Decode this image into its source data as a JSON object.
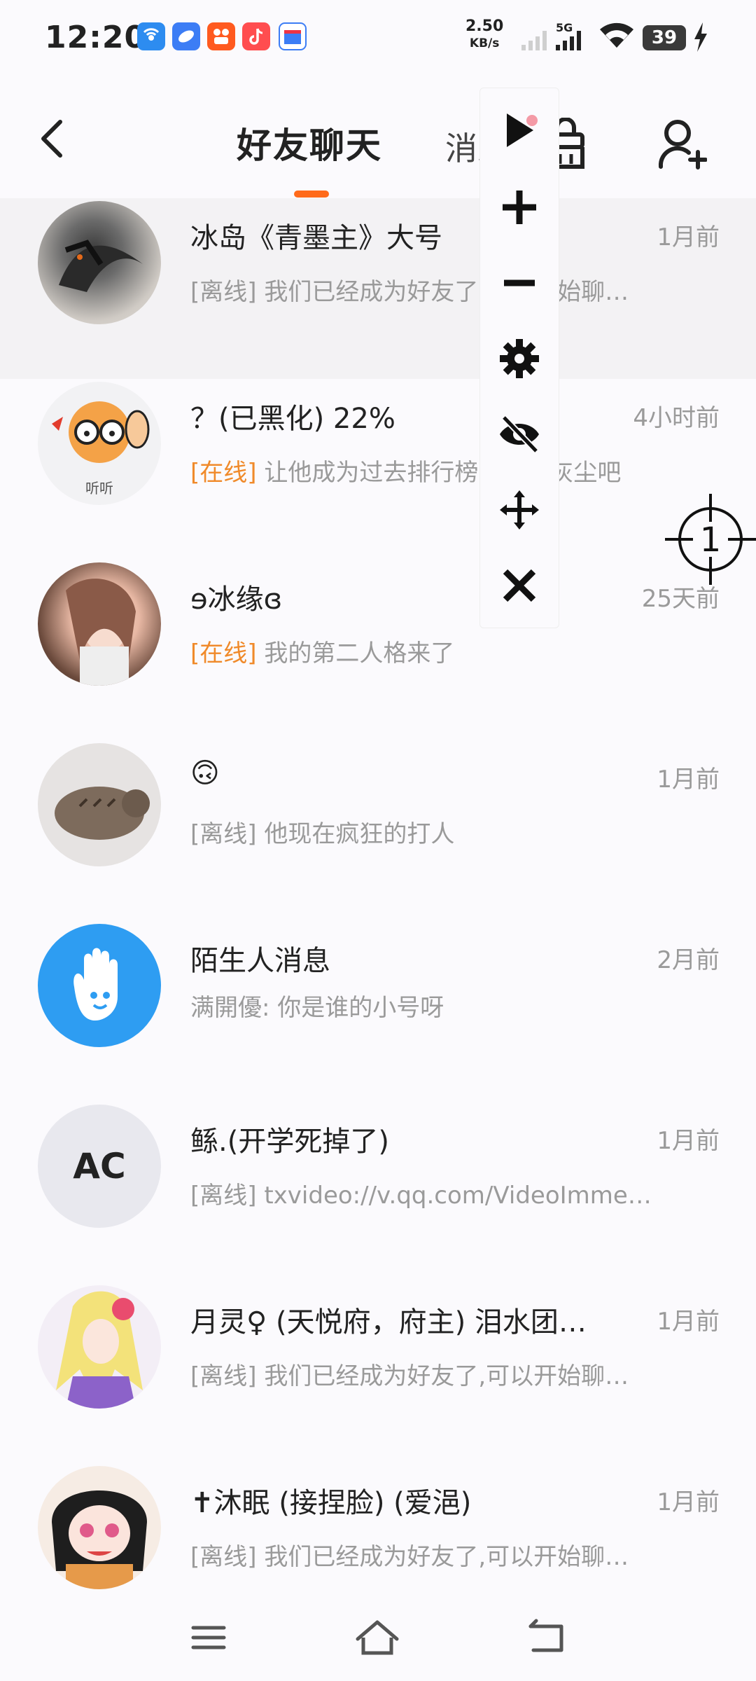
{
  "status_bar": {
    "time": "12:20",
    "net_speed": "2.50",
    "net_unit": "KB/s",
    "network_type": "5G",
    "battery": "39",
    "notification_icons": [
      "wifi-share-icon",
      "browser-icon",
      "kuaishou-icon",
      "douyin-icon",
      "calendar-app-icon"
    ]
  },
  "header": {
    "tab_active": "好友聊天",
    "tab_other": "消息",
    "accent_color": "#ff6a1a"
  },
  "conversations": [
    {
      "name": "冰岛《青墨主》大号",
      "time": "1月前",
      "status": "[离线]",
      "status_type": "offline",
      "preview": "我们已经成为好友了,可以开始聊…"
    },
    {
      "name": "？(已黑化) 22%",
      "time": "4小时前",
      "status": "[在线]",
      "status_type": "online",
      "preview": "让他成为过去排行榜的一挫灰尘吧",
      "avatar_caption": "听听"
    },
    {
      "name": "ɘ冰缘ɞ",
      "time": "25天前",
      "status": "[在线]",
      "status_type": "online",
      "preview": "我的第二人格来了"
    },
    {
      "name": "🙃",
      "time": "1月前",
      "status": "[离线]",
      "status_type": "offline",
      "preview": "他现在疯狂的打人"
    },
    {
      "name": "陌生人消息",
      "time": "2月前",
      "status": "",
      "status_type": "none",
      "preview": "满開優: 你是谁的小号呀"
    },
    {
      "name": "鲧.(开学死掉了)",
      "time": "1月前",
      "status": "[离线]",
      "status_type": "offline",
      "preview": "txvideo://v.qq.com/VideoImme…",
      "avatar_text": "AC"
    },
    {
      "name": "月灵♀ (天悦府，府主) 泪水团…",
      "time": "1月前",
      "status": "[离线]",
      "status_type": "offline",
      "preview": "我们已经成为好友了,可以开始聊…"
    },
    {
      "name": "✝沐眠 (接捏脸) (爱浥)",
      "time": "1月前",
      "status": "[离线]",
      "status_type": "offline",
      "preview": "我们已经成为好友了,可以开始聊…"
    }
  ],
  "floating_panel": {
    "icons": [
      "play-icon",
      "plus-icon",
      "minus-icon",
      "gear-icon",
      "eye-off-icon",
      "move-icon",
      "close-icon"
    ]
  },
  "crosshair": {
    "label": "1"
  },
  "navbar": {
    "icons": [
      "menu-icon",
      "home-icon",
      "back-icon"
    ]
  }
}
